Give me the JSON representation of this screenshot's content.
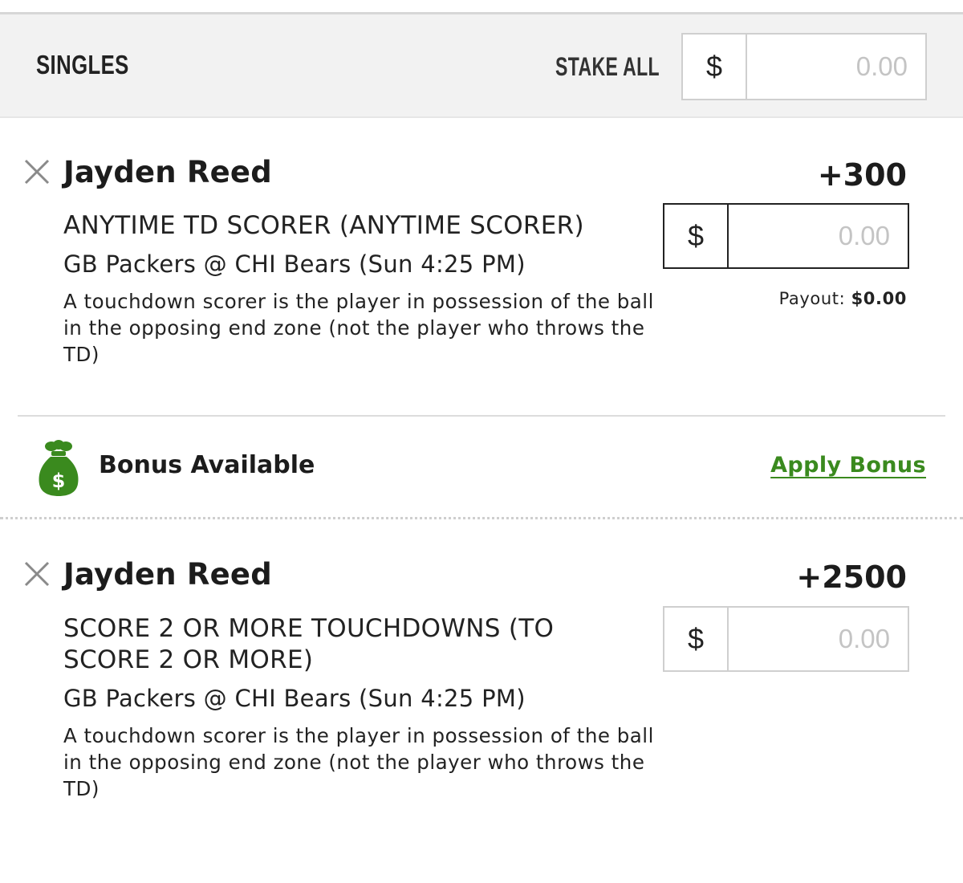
{
  "header": {
    "title": "SINGLES",
    "stake_all_label": "STAKE ALL",
    "currency_symbol": "$",
    "stake_placeholder": "0.00"
  },
  "bets": [
    {
      "player": "Jayden Reed",
      "odds": "+300",
      "market": "ANYTIME TD SCORER (ANYTIME SCORER)",
      "event": "GB Packers @ CHI Bears (Sun 4:25 PM)",
      "rule": "A touchdown scorer is the player in possession of the ball in the opposing end zone (not the player who throws the TD)",
      "currency_symbol": "$",
      "stake_placeholder": "0.00",
      "payout_label": "Payout:",
      "payout_value": "$0.00"
    },
    {
      "player": "Jayden Reed",
      "odds": "+2500",
      "market": "SCORE 2 OR MORE TOUCHDOWNS (TO SCORE 2 OR MORE)",
      "event": "GB Packers @ CHI Bears (Sun 4:25 PM)",
      "rule": "A touchdown scorer is the player in possession of the ball in the opposing end zone (not the player who throws the TD)",
      "currency_symbol": "$",
      "stake_placeholder": "0.00"
    }
  ],
  "bonus": {
    "label": "Bonus Available",
    "link": "Apply Bonus",
    "icon": "money-bag-icon",
    "icon_symbol": "$",
    "accent_color": "#3a8a1e"
  }
}
